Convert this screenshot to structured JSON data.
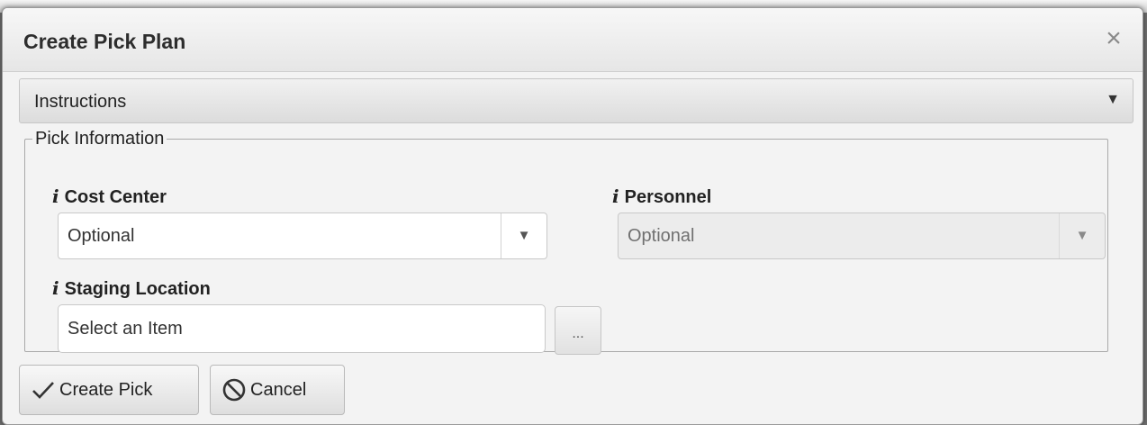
{
  "dialog": {
    "title": "Create Pick Plan",
    "close_glyph": "×"
  },
  "instructions": {
    "label": "Instructions",
    "toggle_glyph": "▼"
  },
  "pick_information": {
    "legend": "Pick Information",
    "info_glyph": "i",
    "cost_center": {
      "label": "Cost Center",
      "placeholder": "Optional",
      "dropdown_glyph": "▼"
    },
    "personnel": {
      "label": "Personnel",
      "placeholder": "Optional",
      "dropdown_glyph": "▼",
      "disabled": true
    },
    "staging_location": {
      "label": "Staging Location",
      "placeholder": "Select an Item",
      "lookup_label": "..."
    }
  },
  "actions": {
    "create_label": "Create Pick",
    "cancel_label": "Cancel"
  },
  "icons": {
    "create": "checkmark-icon",
    "cancel": "prohibited-icon",
    "info": "info-icon"
  }
}
